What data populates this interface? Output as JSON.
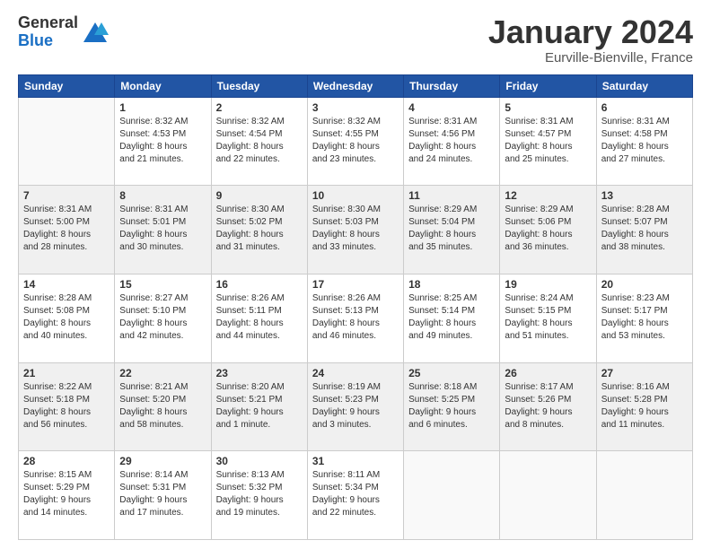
{
  "header": {
    "logo_general": "General",
    "logo_blue": "Blue",
    "month_title": "January 2024",
    "location": "Eurville-Bienville, France"
  },
  "weekdays": [
    "Sunday",
    "Monday",
    "Tuesday",
    "Wednesday",
    "Thursday",
    "Friday",
    "Saturday"
  ],
  "weeks": [
    [
      {
        "day": "",
        "info": ""
      },
      {
        "day": "1",
        "info": "Sunrise: 8:32 AM\nSunset: 4:53 PM\nDaylight: 8 hours\nand 21 minutes."
      },
      {
        "day": "2",
        "info": "Sunrise: 8:32 AM\nSunset: 4:54 PM\nDaylight: 8 hours\nand 22 minutes."
      },
      {
        "day": "3",
        "info": "Sunrise: 8:32 AM\nSunset: 4:55 PM\nDaylight: 8 hours\nand 23 minutes."
      },
      {
        "day": "4",
        "info": "Sunrise: 8:31 AM\nSunset: 4:56 PM\nDaylight: 8 hours\nand 24 minutes."
      },
      {
        "day": "5",
        "info": "Sunrise: 8:31 AM\nSunset: 4:57 PM\nDaylight: 8 hours\nand 25 minutes."
      },
      {
        "day": "6",
        "info": "Sunrise: 8:31 AM\nSunset: 4:58 PM\nDaylight: 8 hours\nand 27 minutes."
      }
    ],
    [
      {
        "day": "7",
        "info": "Sunrise: 8:31 AM\nSunset: 5:00 PM\nDaylight: 8 hours\nand 28 minutes."
      },
      {
        "day": "8",
        "info": "Sunrise: 8:31 AM\nSunset: 5:01 PM\nDaylight: 8 hours\nand 30 minutes."
      },
      {
        "day": "9",
        "info": "Sunrise: 8:30 AM\nSunset: 5:02 PM\nDaylight: 8 hours\nand 31 minutes."
      },
      {
        "day": "10",
        "info": "Sunrise: 8:30 AM\nSunset: 5:03 PM\nDaylight: 8 hours\nand 33 minutes."
      },
      {
        "day": "11",
        "info": "Sunrise: 8:29 AM\nSunset: 5:04 PM\nDaylight: 8 hours\nand 35 minutes."
      },
      {
        "day": "12",
        "info": "Sunrise: 8:29 AM\nSunset: 5:06 PM\nDaylight: 8 hours\nand 36 minutes."
      },
      {
        "day": "13",
        "info": "Sunrise: 8:28 AM\nSunset: 5:07 PM\nDaylight: 8 hours\nand 38 minutes."
      }
    ],
    [
      {
        "day": "14",
        "info": "Sunrise: 8:28 AM\nSunset: 5:08 PM\nDaylight: 8 hours\nand 40 minutes."
      },
      {
        "day": "15",
        "info": "Sunrise: 8:27 AM\nSunset: 5:10 PM\nDaylight: 8 hours\nand 42 minutes."
      },
      {
        "day": "16",
        "info": "Sunrise: 8:26 AM\nSunset: 5:11 PM\nDaylight: 8 hours\nand 44 minutes."
      },
      {
        "day": "17",
        "info": "Sunrise: 8:26 AM\nSunset: 5:13 PM\nDaylight: 8 hours\nand 46 minutes."
      },
      {
        "day": "18",
        "info": "Sunrise: 8:25 AM\nSunset: 5:14 PM\nDaylight: 8 hours\nand 49 minutes."
      },
      {
        "day": "19",
        "info": "Sunrise: 8:24 AM\nSunset: 5:15 PM\nDaylight: 8 hours\nand 51 minutes."
      },
      {
        "day": "20",
        "info": "Sunrise: 8:23 AM\nSunset: 5:17 PM\nDaylight: 8 hours\nand 53 minutes."
      }
    ],
    [
      {
        "day": "21",
        "info": "Sunrise: 8:22 AM\nSunset: 5:18 PM\nDaylight: 8 hours\nand 56 minutes."
      },
      {
        "day": "22",
        "info": "Sunrise: 8:21 AM\nSunset: 5:20 PM\nDaylight: 8 hours\nand 58 minutes."
      },
      {
        "day": "23",
        "info": "Sunrise: 8:20 AM\nSunset: 5:21 PM\nDaylight: 9 hours\nand 1 minute."
      },
      {
        "day": "24",
        "info": "Sunrise: 8:19 AM\nSunset: 5:23 PM\nDaylight: 9 hours\nand 3 minutes."
      },
      {
        "day": "25",
        "info": "Sunrise: 8:18 AM\nSunset: 5:25 PM\nDaylight: 9 hours\nand 6 minutes."
      },
      {
        "day": "26",
        "info": "Sunrise: 8:17 AM\nSunset: 5:26 PM\nDaylight: 9 hours\nand 8 minutes."
      },
      {
        "day": "27",
        "info": "Sunrise: 8:16 AM\nSunset: 5:28 PM\nDaylight: 9 hours\nand 11 minutes."
      }
    ],
    [
      {
        "day": "28",
        "info": "Sunrise: 8:15 AM\nSunset: 5:29 PM\nDaylight: 9 hours\nand 14 minutes."
      },
      {
        "day": "29",
        "info": "Sunrise: 8:14 AM\nSunset: 5:31 PM\nDaylight: 9 hours\nand 17 minutes."
      },
      {
        "day": "30",
        "info": "Sunrise: 8:13 AM\nSunset: 5:32 PM\nDaylight: 9 hours\nand 19 minutes."
      },
      {
        "day": "31",
        "info": "Sunrise: 8:11 AM\nSunset: 5:34 PM\nDaylight: 9 hours\nand 22 minutes."
      },
      {
        "day": "",
        "info": ""
      },
      {
        "day": "",
        "info": ""
      },
      {
        "day": "",
        "info": ""
      }
    ]
  ]
}
